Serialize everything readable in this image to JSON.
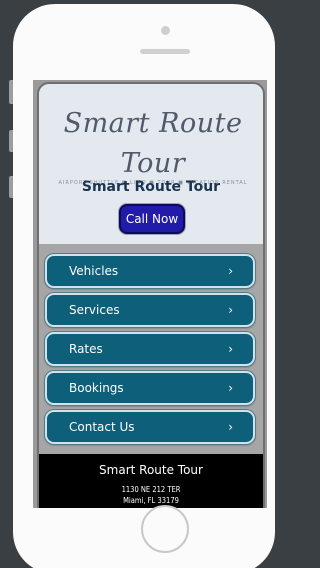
{
  "brand": {
    "logo_text": "Smart Route Tour",
    "logo_tagline": "AIRPORT SHUTTLE ■ LIMO ■ TOUR ■ VACATION RENTAL",
    "title": "Smart Route Tour"
  },
  "call_button": {
    "label": "Call Now"
  },
  "nav": {
    "items": [
      {
        "label": "Vehicles",
        "icon": "chevron-right-icon"
      },
      {
        "label": "Services",
        "icon": "chevron-right-icon"
      },
      {
        "label": "Rates",
        "icon": "chevron-right-icon"
      },
      {
        "label": "Bookings",
        "icon": "chevron-right-icon"
      },
      {
        "label": "Contact Us",
        "icon": "chevron-right-icon"
      }
    ],
    "chevron": "›"
  },
  "footer": {
    "name": "Smart Route Tour",
    "address_line1": "1130 NE 212 TER",
    "address_line2": "Miami, FL 33179"
  },
  "colors": {
    "nav_button": "#0e5f7a",
    "call_button": "#221aa8",
    "title": "#1b3550",
    "footer": "#000000"
  }
}
